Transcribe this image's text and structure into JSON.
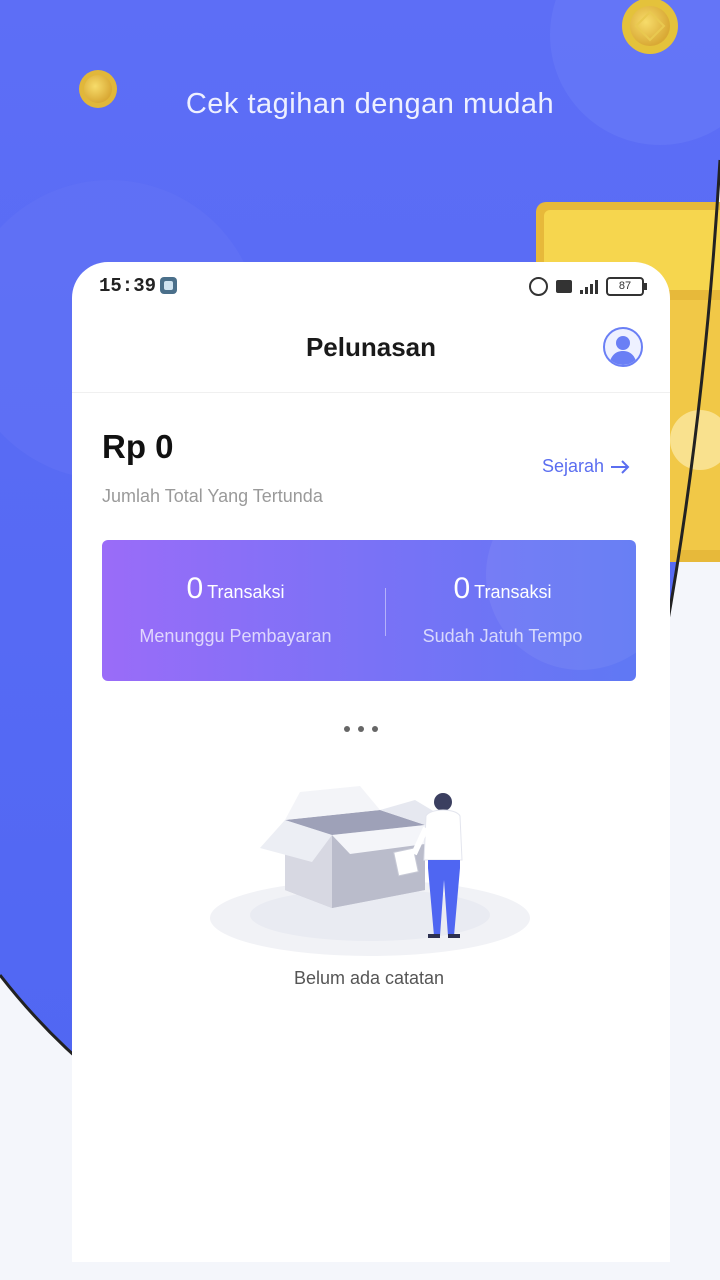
{
  "promo": {
    "tagline": "Cek tagihan dengan mudah",
    "accent_color": "#5f78f4",
    "coin_color": "#f3d33a"
  },
  "status_bar": {
    "time": "15:39",
    "battery": "87"
  },
  "header": {
    "title": "Pelunasan"
  },
  "summary": {
    "amount": "Rp 0",
    "amount_label": "Jumlah Total Yang Tertunda",
    "history_link": "Sejarah"
  },
  "stats": [
    {
      "count": "0",
      "unit": "Transaksi",
      "label": "Menunggu Pembayaran"
    },
    {
      "count": "0",
      "unit": "Transaksi",
      "label": "Sudah Jatuh Tempo"
    }
  ],
  "empty_state": {
    "text": "Belum ada catatan"
  },
  "icons": [
    "avatar-icon",
    "arrow-right-icon",
    "alarm-icon",
    "sim-icon",
    "signal-icon",
    "battery-icon",
    "empty-box-illustration"
  ]
}
